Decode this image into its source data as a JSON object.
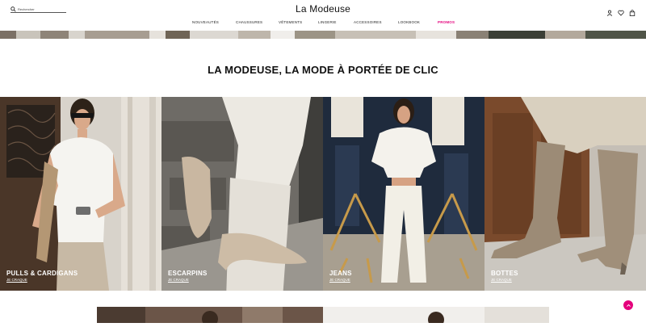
{
  "header": {
    "logo": "La Modeuse",
    "search_placeholder": "Rechercher",
    "nav": [
      {
        "label": "NOUVEAUTÉS"
      },
      {
        "label": "CHAUSSURES"
      },
      {
        "label": "VÊTEMENTS"
      },
      {
        "label": "LINGERIE"
      },
      {
        "label": "ACCESSOIRES"
      },
      {
        "label": "LOOKBOOK"
      },
      {
        "label": "PROMOS"
      }
    ],
    "icons": [
      "user-icon",
      "heart-icon",
      "bag-icon"
    ]
  },
  "main": {
    "title": "LA MODEUSE, LA MODE À PORTÉE DE CLIC",
    "categories": [
      {
        "label": "PULLS & CARDIGANS",
        "cta": "JE CRAQUE"
      },
      {
        "label": "ESCARPINS",
        "cta": "JE CRAQUE"
      },
      {
        "label": "JEANS",
        "cta": "JE CRAQUE"
      },
      {
        "label": "BOTTES",
        "cta": "JE CRAQUE"
      }
    ]
  },
  "colors": {
    "accent": "#e4007c",
    "text": "#111111"
  },
  "scroll_top_icon": "arrow-up-icon"
}
